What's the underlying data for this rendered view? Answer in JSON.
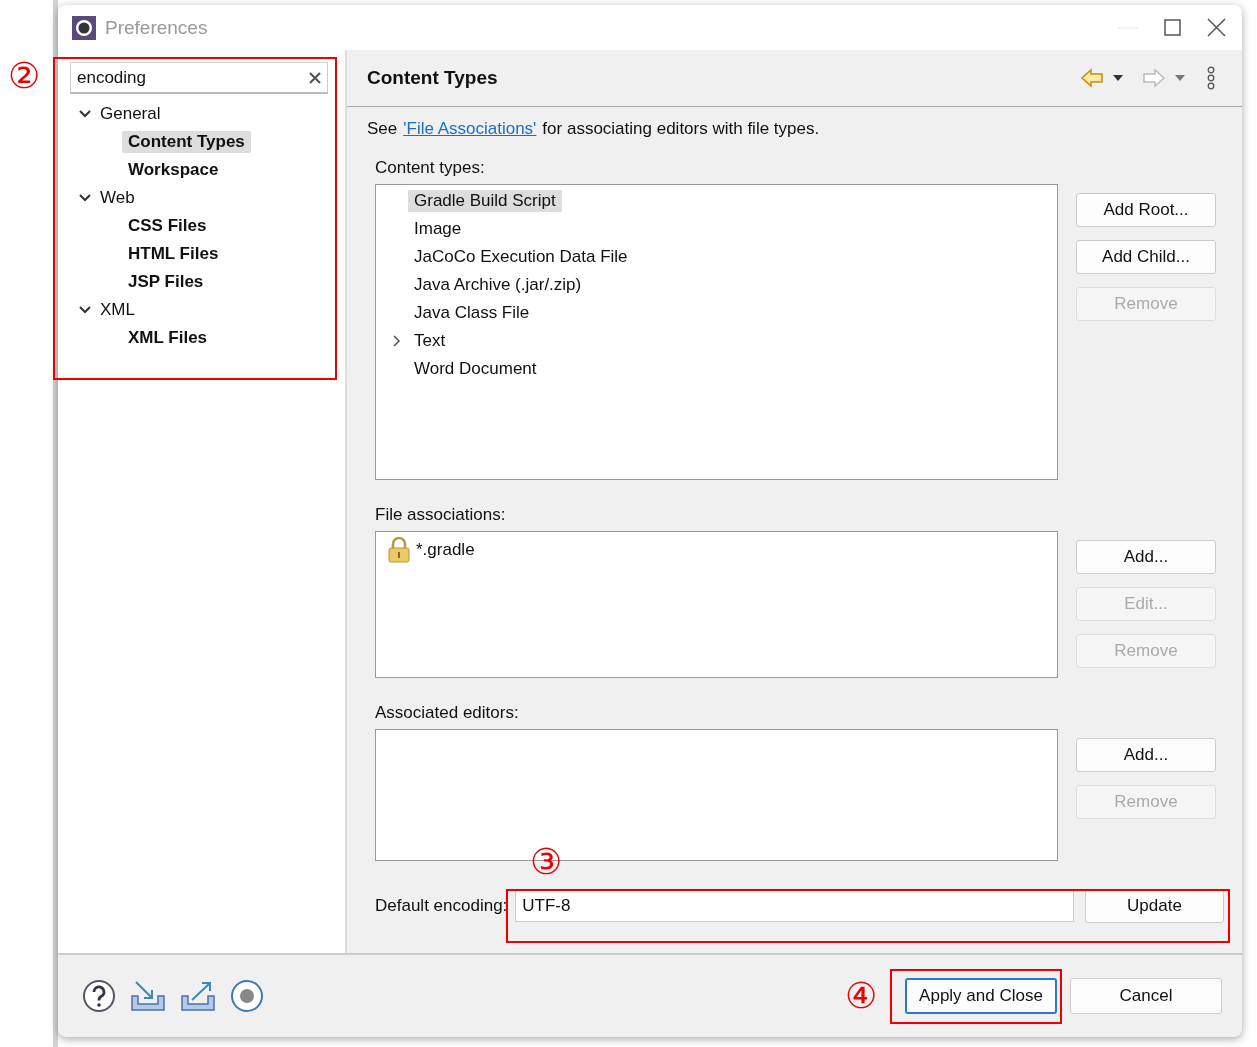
{
  "window": {
    "title": "Preferences"
  },
  "sidebar": {
    "search": {
      "value": "encoding"
    },
    "tree": [
      {
        "label": "General",
        "expanded": true,
        "children": [
          {
            "label": "Content Types",
            "selected": true
          },
          {
            "label": "Workspace",
            "selected": false
          }
        ]
      },
      {
        "label": "Web",
        "expanded": true,
        "children": [
          {
            "label": "CSS Files",
            "selected": false
          },
          {
            "label": "HTML Files",
            "selected": false
          },
          {
            "label": "JSP Files",
            "selected": false
          }
        ]
      },
      {
        "label": "XML",
        "expanded": true,
        "children": [
          {
            "label": "XML Files",
            "selected": false
          }
        ]
      }
    ]
  },
  "page": {
    "title": "Content Types",
    "intro_before": "See",
    "intro_link": "'File Associations'",
    "intro_after": "for associating editors with file types.",
    "content_types": {
      "label": "Content types:",
      "items": [
        {
          "label": "Gradle Build Script",
          "selected": true,
          "has_children": false
        },
        {
          "label": "Image",
          "selected": false,
          "has_children": false
        },
        {
          "label": "JaCoCo Execution Data File",
          "selected": false,
          "has_children": false
        },
        {
          "label": "Java Archive (.jar/.zip)",
          "selected": false,
          "has_children": false
        },
        {
          "label": "Java Class File",
          "selected": false,
          "has_children": false
        },
        {
          "label": "Text",
          "selected": false,
          "has_children": true
        },
        {
          "label": "Word Document",
          "selected": false,
          "has_children": false
        }
      ],
      "buttons": [
        {
          "label": "Add Root...",
          "disabled": false
        },
        {
          "label": "Add Child...",
          "disabled": false
        },
        {
          "label": "Remove",
          "disabled": true
        }
      ]
    },
    "file_associations": {
      "label": "File associations:",
      "items": [
        {
          "label": "*.gradle",
          "locked": true
        }
      ],
      "buttons": [
        {
          "label": "Add...",
          "disabled": false
        },
        {
          "label": "Edit...",
          "disabled": true
        },
        {
          "label": "Remove",
          "disabled": true
        }
      ]
    },
    "associated_editors": {
      "label": "Associated editors:",
      "buttons": [
        {
          "label": "Add...",
          "disabled": false
        },
        {
          "label": "Remove",
          "disabled": true
        }
      ]
    },
    "default_encoding": {
      "label": "Default encoding:",
      "value": "UTF-8",
      "button": "Update"
    }
  },
  "footer": {
    "buttons": [
      {
        "label": "Apply and Close",
        "default": true
      },
      {
        "label": "Cancel",
        "default": false
      }
    ]
  },
  "annotations": [
    {
      "number": "②",
      "kind": "sidebar"
    },
    {
      "number": "③",
      "kind": "encoding"
    },
    {
      "number": "④",
      "kind": "apply"
    }
  ]
}
